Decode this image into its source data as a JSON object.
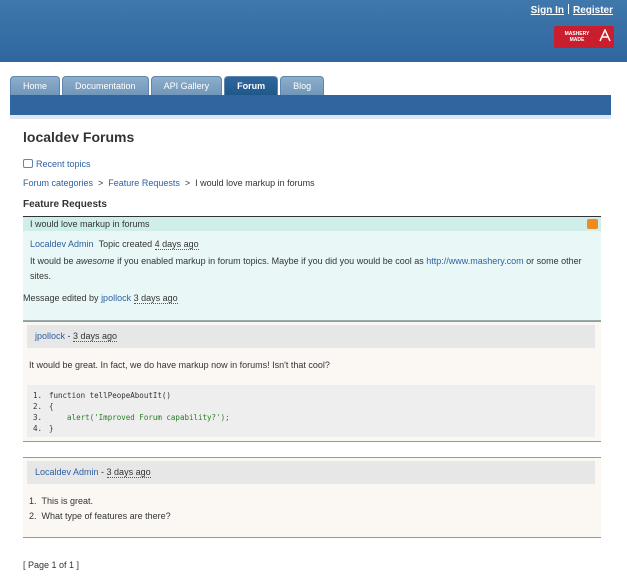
{
  "header": {
    "sign_in": "Sign In",
    "register": "Register",
    "logo_line1": "MASHERY",
    "logo_line2": "MADE"
  },
  "tabs": [
    {
      "label": "Home",
      "active": false
    },
    {
      "label": "Documentation",
      "active": false
    },
    {
      "label": "API Gallery",
      "active": false
    },
    {
      "label": "Forum",
      "active": true
    },
    {
      "label": "Blog",
      "active": false
    }
  ],
  "page_title": "localdev Forums",
  "recent_topics": "Recent topics",
  "breadcrumb": {
    "forum_categories": "Forum categories",
    "feature_requests": "Feature Requests",
    "current": "I would love markup in forums"
  },
  "section_title": "Feature Requests",
  "topic": {
    "title": "I would love markup in forums",
    "author": "Localdev Admin",
    "created_label": "Topic created",
    "created_time": "4 days ago",
    "body_prefix": "It would be ",
    "body_em": "awesome",
    "body_mid": " if you enabled markup in forum topics. Maybe if you did you would be cool as ",
    "body_link": "http://www.mashery.com",
    "body_suffix": " or some other sites.",
    "edited_label": "Message edited by",
    "edited_by": "jpollock",
    "edited_time": "3 days ago"
  },
  "replies": [
    {
      "author": "jpollock",
      "time": "3 days ago",
      "text": "It would be great. In fact, we do have markup now in forums! Isn't that cool?",
      "code": [
        {
          "n": "1.",
          "line": "function tellPeopeAboutIt()"
        },
        {
          "n": "2.",
          "line": "{"
        },
        {
          "n": "3.",
          "line": "    alert('Improved Forum capability?');"
        },
        {
          "n": "4.",
          "line": "}"
        }
      ]
    },
    {
      "author": "Localdev Admin",
      "time": "3 days ago",
      "list": [
        {
          "n": "1.",
          "text": "This is great."
        },
        {
          "n": "2.",
          "text": "What type of features are there?"
        }
      ]
    }
  ],
  "pager": "[ Page 1 of 1 ]",
  "colors": {
    "header": "#3f78ab",
    "link": "#2d5fa3",
    "topic_bg": "#e9f8f6",
    "rss": "#f08a1e",
    "logo": "#c81e2d"
  }
}
